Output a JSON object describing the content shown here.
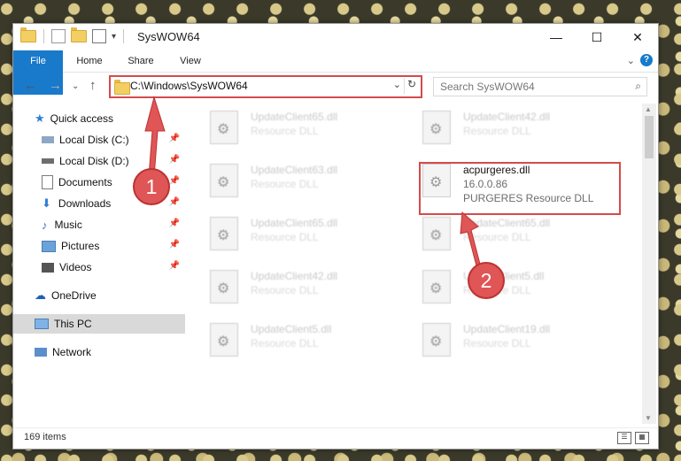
{
  "window": {
    "title": "SysWOW64",
    "controls": {
      "minimize": "—",
      "maximize": "☐",
      "close": "✕"
    }
  },
  "ribbon": {
    "tabs": [
      {
        "label": "File"
      },
      {
        "label": "Home"
      },
      {
        "label": "Share"
      },
      {
        "label": "View"
      }
    ],
    "help": "?"
  },
  "address": {
    "path": "C:\\Windows\\SysWOW64",
    "search_placeholder": "Search SysWOW64"
  },
  "sidebar": {
    "items": [
      {
        "label": "Quick access"
      },
      {
        "label": "Local Disk (C:)"
      },
      {
        "label": "Local Disk (D:)"
      },
      {
        "label": "Documents"
      },
      {
        "label": "Downloads"
      },
      {
        "label": "Music"
      },
      {
        "label": "Pictures"
      },
      {
        "label": "Videos"
      },
      {
        "label": "OneDrive"
      },
      {
        "label": "This PC"
      },
      {
        "label": "Network"
      }
    ]
  },
  "files": [
    {
      "name": "UpdateClient65.dll",
      "desc": "Resource DLL"
    },
    {
      "name": "UpdateClient42.dll",
      "desc": "Resource DLL"
    },
    {
      "name": "UpdateClient63.dll",
      "desc": "Resource DLL"
    },
    {
      "name": "acpurgeres.dll",
      "version": "16.0.0.86",
      "desc": "PURGERES Resource DLL"
    },
    {
      "name": "UpdateClient65.dll",
      "desc": "Resource DLL"
    },
    {
      "name": "UpdateClient65.dll",
      "desc": "Resource DLL"
    },
    {
      "name": "UpdateClient42.dll",
      "desc": "Resource DLL"
    },
    {
      "name": "UpdateClient5.dll",
      "desc": "Resource DLL"
    },
    {
      "name": "UpdateClient5.dll",
      "desc": "Resource DLL"
    },
    {
      "name": "UpdateClient19.dll",
      "desc": "Resource DLL"
    }
  ],
  "status": {
    "items": "169 items"
  },
  "annotations": {
    "badge1": "1",
    "badge2": "2"
  },
  "colors": {
    "accent": "#1979ca",
    "highlight": "#d44b4b"
  }
}
